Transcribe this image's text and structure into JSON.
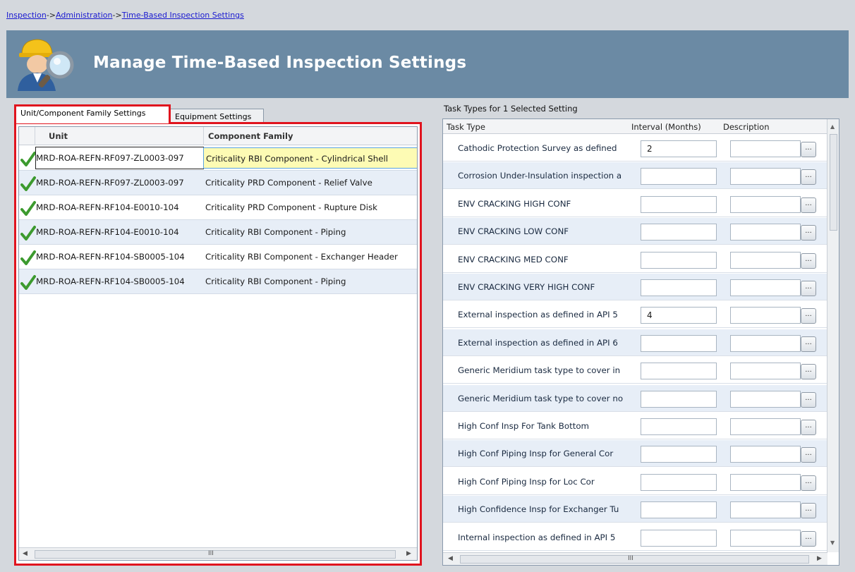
{
  "breadcrumb": {
    "items": [
      "Inspection",
      "Administration",
      "Time-Based Inspection Settings"
    ],
    "separator": "->"
  },
  "header": {
    "title": "Manage Time-Based Inspection Settings",
    "background": "#6b8aa4"
  },
  "left_tabs": {
    "active": "Unit/Component Family Settings",
    "inactive": "Equipment Settings"
  },
  "unit_grid": {
    "columns": {
      "unit": "Unit",
      "component_family": "Component Family"
    },
    "rows": [
      {
        "unit": "MRD-ROA-REFN-RF097-ZL0003-097",
        "family": "Criticality RBI Component - Cylindrical Shell",
        "checked": true,
        "selected": true
      },
      {
        "unit": "MRD-ROA-REFN-RF097-ZL0003-097",
        "family": "Criticality PRD Component - Relief Valve",
        "checked": true,
        "selected": false
      },
      {
        "unit": "MRD-ROA-REFN-RF104-E0010-104",
        "family": "Criticality PRD Component - Rupture Disk",
        "checked": true,
        "selected": false
      },
      {
        "unit": "MRD-ROA-REFN-RF104-E0010-104",
        "family": "Criticality RBI Component - Piping",
        "checked": true,
        "selected": false
      },
      {
        "unit": "MRD-ROA-REFN-RF104-SB0005-104",
        "family": "Criticality RBI Component - Exchanger Header",
        "checked": true,
        "selected": false
      },
      {
        "unit": "MRD-ROA-REFN-RF104-SB0005-104",
        "family": "Criticality RBI Component - Piping",
        "checked": true,
        "selected": false
      }
    ],
    "scroll_grip": "III",
    "highlight_color": "#e0141e"
  },
  "task_types": {
    "title": "Task Types for 1 Selected Setting",
    "columns": {
      "task_type": "Task Type",
      "interval": "Interval (Months)",
      "description": "Description"
    },
    "ellipsis": "...",
    "rows": [
      {
        "task_type": "Cathodic Protection Survey as defined",
        "interval": "2",
        "description": ""
      },
      {
        "task_type": "Corrosion Under-Insulation inspection a",
        "interval": "",
        "description": ""
      },
      {
        "task_type": "ENV CRACKING  HIGH CONF",
        "interval": "",
        "description": ""
      },
      {
        "task_type": "ENV CRACKING  LOW CONF",
        "interval": "",
        "description": ""
      },
      {
        "task_type": "ENV CRACKING  MED CONF",
        "interval": "",
        "description": ""
      },
      {
        "task_type": "ENV CRACKING VERY HIGH CONF",
        "interval": "",
        "description": ""
      },
      {
        "task_type": "External inspection as defined in API 5",
        "interval": "4",
        "description": ""
      },
      {
        "task_type": "External inspection as defined in API 6",
        "interval": "",
        "description": ""
      },
      {
        "task_type": "Generic Meridium task type to cover in",
        "interval": "",
        "description": ""
      },
      {
        "task_type": "Generic Meridium task type to cover no",
        "interval": "",
        "description": ""
      },
      {
        "task_type": "High Conf Insp For Tank Bottom",
        "interval": "",
        "description": ""
      },
      {
        "task_type": "High Conf Piping Insp for General Cor",
        "interval": "",
        "description": ""
      },
      {
        "task_type": "High Conf Piping Insp for Loc Cor",
        "interval": "",
        "description": ""
      },
      {
        "task_type": "High Confidence Insp for Exchanger Tu",
        "interval": "",
        "description": ""
      },
      {
        "task_type": "Internal inspection as defined in API 5",
        "interval": "",
        "description": ""
      }
    ],
    "scroll_grip": "III"
  }
}
